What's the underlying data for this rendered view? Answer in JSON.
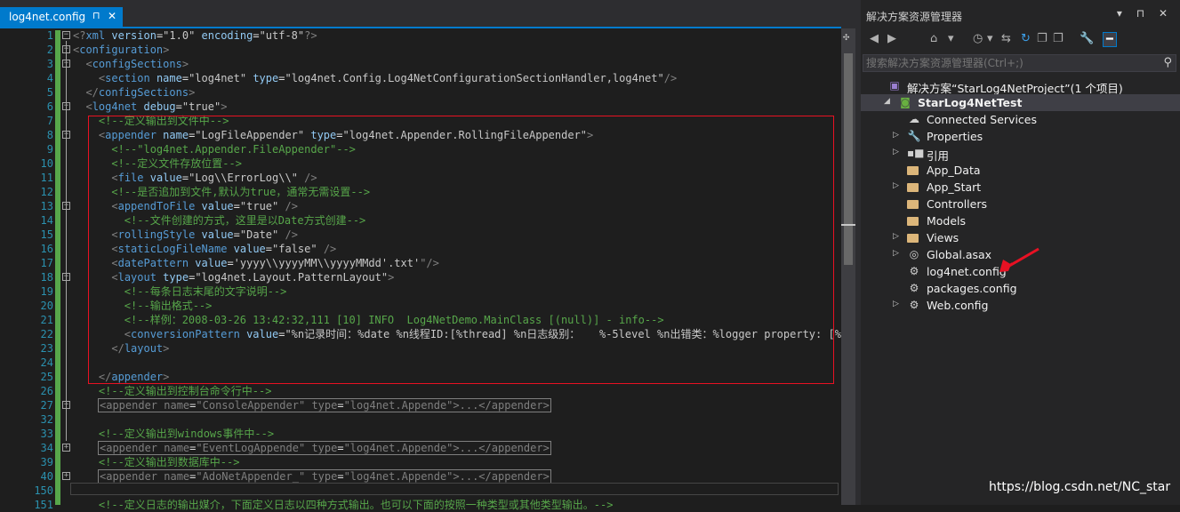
{
  "editor": {
    "tab_title": "log4net.config",
    "tab_pin": "⊓",
    "tab_close": "✕",
    "lines": [
      {
        "n": "1",
        "fold": "-",
        "code": [
          [
            "p",
            "<?"
          ],
          [
            "t",
            "xml"
          ],
          [
            "a",
            " version"
          ],
          [
            "x",
            "="
          ],
          [
            "v",
            "\"1.0\""
          ],
          [
            "a",
            " encoding"
          ],
          [
            "x",
            "="
          ],
          [
            "v",
            "\"utf-8\""
          ],
          [
            "p",
            "?>"
          ]
        ]
      },
      {
        "n": "2",
        "fold": "-",
        "code": [
          [
            "p",
            "<"
          ],
          [
            "t",
            "configuration"
          ],
          [
            "p",
            ">"
          ]
        ]
      },
      {
        "n": "3",
        "fold": "-",
        "code": [
          [
            "x",
            "  "
          ],
          [
            "p",
            "<"
          ],
          [
            "t",
            "configSections"
          ],
          [
            "p",
            ">"
          ]
        ]
      },
      {
        "n": "4",
        "fold": "",
        "code": [
          [
            "x",
            "    "
          ],
          [
            "p",
            "<"
          ],
          [
            "t",
            "section"
          ],
          [
            "a",
            " name"
          ],
          [
            "x",
            "="
          ],
          [
            "v",
            "\"log4net\""
          ],
          [
            "a",
            " type"
          ],
          [
            "x",
            "="
          ],
          [
            "v",
            "\"log4net.Config.Log4NetConfigurationSectionHandler,log4net\""
          ],
          [
            "p",
            "/>"
          ]
        ]
      },
      {
        "n": "5",
        "fold": "",
        "code": [
          [
            "x",
            "  "
          ],
          [
            "p",
            "</"
          ],
          [
            "t",
            "configSections"
          ],
          [
            "p",
            ">"
          ]
        ]
      },
      {
        "n": "6",
        "fold": "-",
        "code": [
          [
            "x",
            "  "
          ],
          [
            "p",
            "<"
          ],
          [
            "t",
            "log4net"
          ],
          [
            "a",
            " debug"
          ],
          [
            "x",
            "="
          ],
          [
            "v",
            "\"true\""
          ],
          [
            "p",
            ">"
          ]
        ]
      },
      {
        "n": "7",
        "fold": "",
        "code": [
          [
            "x",
            "    "
          ],
          [
            "c",
            "<!--定义输出到文件中-->"
          ]
        ]
      },
      {
        "n": "8",
        "fold": "-",
        "code": [
          [
            "x",
            "    "
          ],
          [
            "p",
            "<"
          ],
          [
            "t",
            "appender"
          ],
          [
            "a",
            " name"
          ],
          [
            "x",
            "="
          ],
          [
            "v",
            "\"LogFileAppender\""
          ],
          [
            "a",
            " type"
          ],
          [
            "x",
            "="
          ],
          [
            "v",
            "\"log4net.Appender.RollingFileAppender\""
          ],
          [
            "p",
            ">"
          ]
        ]
      },
      {
        "n": "9",
        "fold": "",
        "code": [
          [
            "x",
            "      "
          ],
          [
            "c",
            "<!--\"log4net.Appender.FileAppender\"-->"
          ]
        ]
      },
      {
        "n": "10",
        "fold": "",
        "code": [
          [
            "x",
            "      "
          ],
          [
            "c",
            "<!--定义文件存放位置-->"
          ]
        ]
      },
      {
        "n": "11",
        "fold": "",
        "code": [
          [
            "x",
            "      "
          ],
          [
            "p",
            "<"
          ],
          [
            "t",
            "file"
          ],
          [
            "a",
            " value"
          ],
          [
            "x",
            "="
          ],
          [
            "v",
            "\"Log\\\\ErrorLog\\\\\""
          ],
          [
            "p",
            " />"
          ]
        ]
      },
      {
        "n": "12",
        "fold": "",
        "code": [
          [
            "x",
            "      "
          ],
          [
            "c",
            "<!--是否追加到文件,默认为true，通常无需设置-->"
          ]
        ]
      },
      {
        "n": "13",
        "fold": "-",
        "code": [
          [
            "x",
            "      "
          ],
          [
            "p",
            "<"
          ],
          [
            "t",
            "appendToFile"
          ],
          [
            "a",
            " value"
          ],
          [
            "x",
            "="
          ],
          [
            "v",
            "\"true\""
          ],
          [
            "p",
            " />"
          ]
        ]
      },
      {
        "n": "14",
        "fold": "",
        "code": [
          [
            "x",
            "        "
          ],
          [
            "c",
            "<!--文件创建的方式，这里是以Date方式创建-->"
          ]
        ]
      },
      {
        "n": "15",
        "fold": "",
        "code": [
          [
            "x",
            "      "
          ],
          [
            "p",
            "<"
          ],
          [
            "t",
            "rollingStyle"
          ],
          [
            "a",
            " value"
          ],
          [
            "x",
            "="
          ],
          [
            "v",
            "\"Date\""
          ],
          [
            "p",
            " />"
          ]
        ]
      },
      {
        "n": "16",
        "fold": "",
        "code": [
          [
            "x",
            "      "
          ],
          [
            "p",
            "<"
          ],
          [
            "t",
            "staticLogFileName"
          ],
          [
            "a",
            " value"
          ],
          [
            "x",
            "="
          ],
          [
            "v",
            "\"false\""
          ],
          [
            "p",
            " />"
          ]
        ]
      },
      {
        "n": "17",
        "fold": "",
        "code": [
          [
            "x",
            "      "
          ],
          [
            "p",
            "<"
          ],
          [
            "t",
            "datePattern"
          ],
          [
            "a",
            " value"
          ],
          [
            "x",
            "="
          ],
          [
            "v",
            "'yyyy\\\\yyyyMM\\\\yyyyMMdd'.txt'"
          ],
          [
            "p",
            "\"/>"
          ]
        ]
      },
      {
        "n": "18",
        "fold": "-",
        "code": [
          [
            "x",
            "      "
          ],
          [
            "p",
            "<"
          ],
          [
            "t",
            "layout"
          ],
          [
            "a",
            " type"
          ],
          [
            "x",
            "="
          ],
          [
            "v",
            "\"log4net.Layout.PatternLayout\""
          ],
          [
            "p",
            ">"
          ]
        ]
      },
      {
        "n": "19",
        "fold": "",
        "code": [
          [
            "x",
            "        "
          ],
          [
            "c",
            "<!--每条日志末尾的文字说明-->"
          ]
        ]
      },
      {
        "n": "20",
        "fold": "",
        "code": [
          [
            "x",
            "        "
          ],
          [
            "c",
            "<!--输出格式-->"
          ]
        ]
      },
      {
        "n": "21",
        "fold": "",
        "code": [
          [
            "x",
            "        "
          ],
          [
            "c",
            "<!--样例：2008-03-26 13:42:32,111 [10] INFO  Log4NetDemo.MainClass [(null)] - info-->"
          ]
        ]
      },
      {
        "n": "22",
        "fold": "",
        "code": [
          [
            "x",
            "        "
          ],
          [
            "p",
            "<"
          ],
          [
            "t",
            "conversionPattern"
          ],
          [
            "a",
            " value"
          ],
          [
            "x",
            "="
          ],
          [
            "v",
            "\"%n记录时间：%date %n线程ID:[%thread] %n日志级别：   %-5level %n出错类：%logger property: [%"
          ]
        ]
      },
      {
        "n": "23",
        "fold": "",
        "code": [
          [
            "x",
            "      "
          ],
          [
            "p",
            "</"
          ],
          [
            "t",
            "layout"
          ],
          [
            "p",
            ">"
          ]
        ]
      },
      {
        "n": "24",
        "fold": "",
        "code": []
      },
      {
        "n": "25",
        "fold": "",
        "code": [
          [
            "x",
            "    "
          ],
          [
            "p",
            "</"
          ],
          [
            "t",
            "appender"
          ],
          [
            "p",
            ">"
          ]
        ]
      },
      {
        "n": "26",
        "fold": "",
        "code": [
          [
            "x",
            "    "
          ],
          [
            "c",
            "<!--定义输出到控制台命令行中-->"
          ]
        ]
      },
      {
        "n": "27",
        "fold": "+",
        "collapsed": true,
        "code": [
          [
            "p",
            "<"
          ],
          [
            "t",
            "appender"
          ],
          [
            "a",
            " name"
          ],
          [
            "x",
            "="
          ],
          [
            "v",
            "\"ConsoleAppender\""
          ],
          [
            "a",
            " type"
          ],
          [
            "x",
            "="
          ],
          [
            "v",
            "\"log4net.Appende\""
          ],
          [
            "p",
            ">...</"
          ],
          [
            "t",
            "appender"
          ],
          [
            "p",
            ">"
          ]
        ]
      },
      {
        "n": "32",
        "fold": "",
        "code": []
      },
      {
        "n": "33",
        "fold": "",
        "code": [
          [
            "x",
            "    "
          ],
          [
            "c",
            "<!--定义输出到windows事件中-->"
          ]
        ]
      },
      {
        "n": "34",
        "fold": "+",
        "collapsed": true,
        "code": [
          [
            "p",
            "<"
          ],
          [
            "t",
            "appender"
          ],
          [
            "a",
            " name"
          ],
          [
            "x",
            "="
          ],
          [
            "v",
            "\"EventLogAppende\""
          ],
          [
            "a",
            " type"
          ],
          [
            "x",
            "="
          ],
          [
            "v",
            "\"log4net.Appende\""
          ],
          [
            "p",
            ">...</"
          ],
          [
            "t",
            "appender"
          ],
          [
            "p",
            ">"
          ]
        ]
      },
      {
        "n": "39",
        "fold": "",
        "code": [
          [
            "x",
            "    "
          ],
          [
            "c",
            "<!--定义输出到数据库中-->"
          ]
        ]
      },
      {
        "n": "40",
        "fold": "+",
        "collapsed": true,
        "code": [
          [
            "p",
            "<"
          ],
          [
            "t",
            "appender"
          ],
          [
            "a",
            " name"
          ],
          [
            "x",
            "="
          ],
          [
            "v",
            "\"AdoNetAppender_\""
          ],
          [
            "a",
            " type"
          ],
          [
            "x",
            "="
          ],
          [
            "v",
            "\"log4net.Appende\""
          ],
          [
            "p",
            ">...</"
          ],
          [
            "t",
            "appender"
          ],
          [
            "p",
            ">"
          ]
        ]
      },
      {
        "n": "150",
        "fold": "",
        "code": []
      },
      {
        "n": "151",
        "fold": "",
        "code": [
          [
            "x",
            "    "
          ],
          [
            "c",
            "<!--定义日志的输出媒介，下面定义日志以四种方式输出。也可以下面的按照一种类型或其他类型输出。-->"
          ]
        ]
      }
    ]
  },
  "explorer": {
    "title": "解决方案资源管理器",
    "title_buttons": "▾ ⊓ ✕",
    "search_placeholder": "搜索解决方案资源管理器(Ctrl+;)",
    "search_icon": "⚲",
    "toolbar": [
      "◀",
      "▶",
      "⌂",
      "▾",
      "◷",
      "▾",
      "⇆",
      "↻",
      "❐",
      "❐",
      "🔧",
      "━"
    ],
    "nodes": [
      {
        "label": "解决方案“StarLog4NetProject”(1 个项目)",
        "indent": 0,
        "arrow": "",
        "icon": "solution",
        "selected": false,
        "bold": false
      },
      {
        "label": "StarLog4NetTest",
        "indent": 1,
        "arrow": "◢",
        "icon": "project",
        "selected": true,
        "bold": true
      },
      {
        "label": "Connected Services",
        "indent": 2,
        "arrow": "",
        "icon": "cloud",
        "selected": false,
        "bold": false
      },
      {
        "label": "Properties",
        "indent": 2,
        "arrow": "▷",
        "icon": "wrench",
        "selected": false,
        "bold": false
      },
      {
        "label": "引用",
        "indent": 2,
        "arrow": "▷",
        "icon": "refs",
        "selected": false,
        "bold": false
      },
      {
        "label": "App_Data",
        "indent": 2,
        "arrow": "",
        "icon": "folder",
        "selected": false,
        "bold": false
      },
      {
        "label": "App_Start",
        "indent": 2,
        "arrow": "▷",
        "icon": "folder",
        "selected": false,
        "bold": false
      },
      {
        "label": "Controllers",
        "indent": 2,
        "arrow": "",
        "icon": "folder",
        "selected": false,
        "bold": false
      },
      {
        "label": "Models",
        "indent": 2,
        "arrow": "",
        "icon": "folder",
        "selected": false,
        "bold": false
      },
      {
        "label": "Views",
        "indent": 2,
        "arrow": "▷",
        "icon": "folder",
        "selected": false,
        "bold": false
      },
      {
        "label": "Global.asax",
        "indent": 2,
        "arrow": "▷",
        "icon": "globe",
        "selected": false,
        "bold": false
      },
      {
        "label": "log4net.config",
        "indent": 2,
        "arrow": "",
        "icon": "config",
        "selected": false,
        "bold": false
      },
      {
        "label": "packages.config",
        "indent": 2,
        "arrow": "",
        "icon": "config",
        "selected": false,
        "bold": false
      },
      {
        "label": "Web.config",
        "indent": 2,
        "arrow": "▷",
        "icon": "config",
        "selected": false,
        "bold": false
      }
    ]
  },
  "watermark": "https://blog.csdn.net/NC_star",
  "colors": {
    "accent": "#007acc",
    "annotation": "#e81123",
    "comment": "#57a64a",
    "tag": "#569cd6"
  }
}
